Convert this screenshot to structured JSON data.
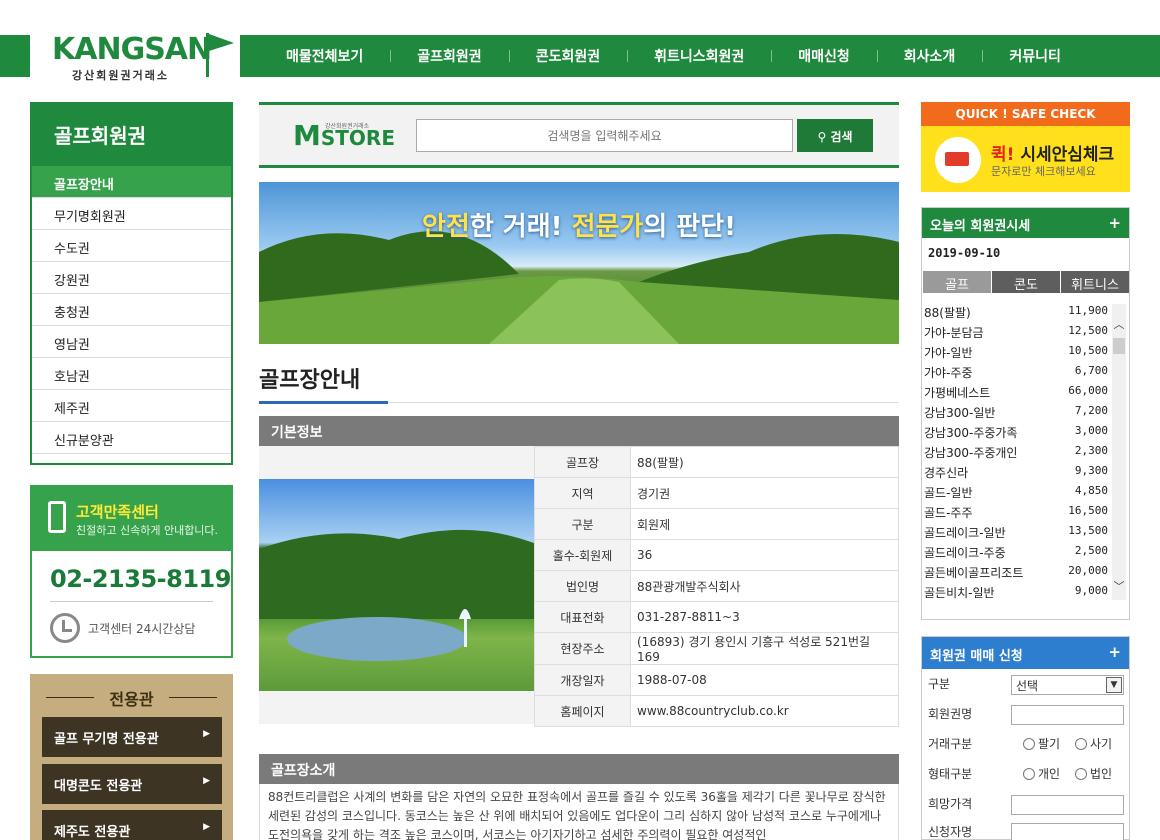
{
  "header": {
    "logo": "KANGSAN",
    "logo_sub": "강산회원권거래소",
    "nav": [
      "매물전체보기",
      "골프회원권",
      "콘도회원권",
      "휘트니스회원권",
      "매매신청",
      "회사소개",
      "커뮤니티"
    ]
  },
  "sidebar": {
    "title": "골프회원권",
    "items": [
      "골프장안내",
      "무기명회원권",
      "수도권",
      "강원권",
      "충청권",
      "영남권",
      "호남권",
      "제주권",
      "신규분양관"
    ]
  },
  "customer_center": {
    "title": "고객만족센터",
    "subtitle": "친절하고 신속하게 안내합니다.",
    "phone": "02-2135-8119",
    "hours": "고객센터 24시간상담"
  },
  "dedicated": {
    "title": "전용관",
    "buttons": [
      "골프 무기명 전용관",
      "대명콘도 전용관",
      "제주도 전용관"
    ]
  },
  "search": {
    "brand_m": "M",
    "brand_store": "STORE",
    "brand_tiny": "강산회원권거래소",
    "placeholder": "검색명을 입력해주세요",
    "button": "검색"
  },
  "banner": {
    "part1": "안전",
    "part2": "한 거래! ",
    "part3": "전문가",
    "part4": "의 판단!"
  },
  "main": {
    "title": "골프장안내",
    "basic_info_title": "기본정보",
    "info": [
      {
        "k": "골프장",
        "v": "88(팔팔)"
      },
      {
        "k": "지역",
        "v": "경기권"
      },
      {
        "k": "구분",
        "v": "회원제"
      },
      {
        "k": "홀수-회원제",
        "v": "36"
      },
      {
        "k": "법인명",
        "v": "88관광개발주식회사"
      },
      {
        "k": "대표전화",
        "v": "031-287-8811~3"
      },
      {
        "k": "현장주소",
        "v": "(16893) 경기 용인시 기흥구 석성로 521번길 169"
      },
      {
        "k": "개장일자",
        "v": "1988-07-08"
      },
      {
        "k": "홈페이지",
        "v": "www.88countryclub.co.kr"
      }
    ],
    "intro_title": "골프장소개",
    "intro_text": "88컨트리클럽은 사계의 변화를 담은 자연의 오묘한 표정속에서 골프를 즐길 수 있도록 36홀을 제각기 다른 꽃나무로 장식한 세련된 감성의 코스입니다. 동코스는 높은 산 위에 배치되어 있음에도 업다운이 그리 심하지 않아 남성적 코스로 누구에게나 도전의욕을 갖게 하는 격조 높은 코스이며, 서코스는 아기자기하고 섬세한 주의력이 필요한 여성적인"
  },
  "quick_check": {
    "top": "QUICK ! SAFE CHECK",
    "title_red": "퀵!",
    "title": " 시세안심체크",
    "sub": "문자로만 체크해보세요"
  },
  "prices": {
    "title": "오늘의 회원권시세",
    "plus": "+",
    "date": "2019-09-10",
    "tabs": [
      "골프",
      "콘도",
      "휘트니스"
    ],
    "rows": [
      {
        "name": "88(팔팔)",
        "value": "11,900"
      },
      {
        "name": "가야-분담금",
        "value": "12,500"
      },
      {
        "name": "가야-일반",
        "value": "10,500"
      },
      {
        "name": "가야-주중",
        "value": "6,700"
      },
      {
        "name": "가평베네스트",
        "value": "66,000"
      },
      {
        "name": "강남300-일반",
        "value": "7,200"
      },
      {
        "name": "강남300-주중가족",
        "value": "3,000"
      },
      {
        "name": "강남300-주중개인",
        "value": "2,300"
      },
      {
        "name": "경주신라",
        "value": "9,300"
      },
      {
        "name": "골드-일반",
        "value": "4,850"
      },
      {
        "name": "골드-주주",
        "value": "16,500"
      },
      {
        "name": "골드레이크-일반",
        "value": "13,500"
      },
      {
        "name": "골드레이크-주중",
        "value": "2,500"
      },
      {
        "name": "골든베이골프리조트",
        "value": "20,000"
      },
      {
        "name": "골든비치-일반",
        "value": "9,000"
      }
    ]
  },
  "apply": {
    "title": "회원권 매매 신청",
    "plus": "+",
    "label_type": "구분",
    "select_value": "선택",
    "label_name": "회원권명",
    "label_trade": "거래구분",
    "trade_sell": "팔기",
    "trade_buy": "사기",
    "label_form": "형태구분",
    "form_personal": "개인",
    "form_corp": "법인",
    "label_price": "희망가격",
    "label_applicant": "신청자명"
  }
}
